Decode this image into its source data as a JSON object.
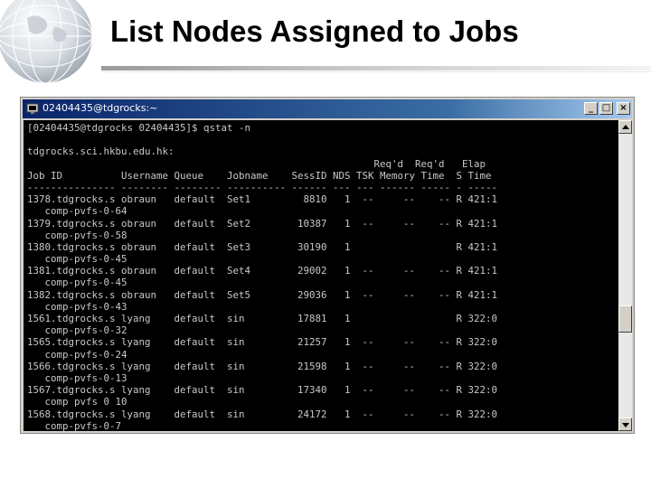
{
  "slide": {
    "title": "List Nodes Assigned to Jobs"
  },
  "window": {
    "title": "02404435@tdgrocks:~",
    "controls": [
      "_",
      "□",
      "×"
    ]
  },
  "terminal": {
    "lines": [
      "[02404435@tdgrocks 02404435]$ qstat -n",
      "",
      "tdgrocks.sci.hkbu.edu.hk:",
      "                                                           Req'd  Req'd   Elap",
      "Job ID          Username Queue    Jobname    SessID NDS TSK Memory Time  S Time",
      "--------------- -------- -------- ---------- ------ --- --- ------ ----- - -----",
      "1378.tdgrocks.s obraun   default  Set1         8810   1  --     --    -- R 421:1",
      "   comp-pvfs-0-64",
      "1379.tdgrocks.s obraun   default  Set2        10387   1  --     --    -- R 421:1",
      "   comp-pvfs-0-58",
      "1380.tdgrocks.s obraun   default  Set3        30190   1                  R 421:1",
      "   comp-pvfs-0-45",
      "1381.tdgrocks.s obraun   default  Set4        29002   1  --     --    -- R 421:1",
      "   comp-pvfs-0-45",
      "1382.tdgrocks.s obraun   default  Set5        29036   1  --     --    -- R 421:1",
      "   comp-pvfs-0-43",
      "1561.tdgrocks.s lyang    default  sin         17881   1                  R 322:0",
      "   comp-pvfs-0-32",
      "1565.tdgrocks.s lyang    default  sin         21257   1  --     --    -- R 322:0",
      "   comp-pvfs-0-24",
      "1566.tdgrocks.s lyang    default  sin         21598   1  --     --    -- R 322:0",
      "   comp-pvfs-0-13",
      "1567.tdgrocks.s lyang    default  sin         17340   1  --     --    -- R 322:0",
      "   comp pvfs 0 10",
      "1568.tdgrocks.s lyang    default  sin         24172   1  --     --    -- R 322:0",
      "   comp-pvfs-0-7"
    ]
  },
  "colors": {
    "terminal_bg": "#000000",
    "terminal_fg": "#c8c8c8",
    "titlebar_start": "#0a246a",
    "titlebar_end": "#a6caf0"
  }
}
